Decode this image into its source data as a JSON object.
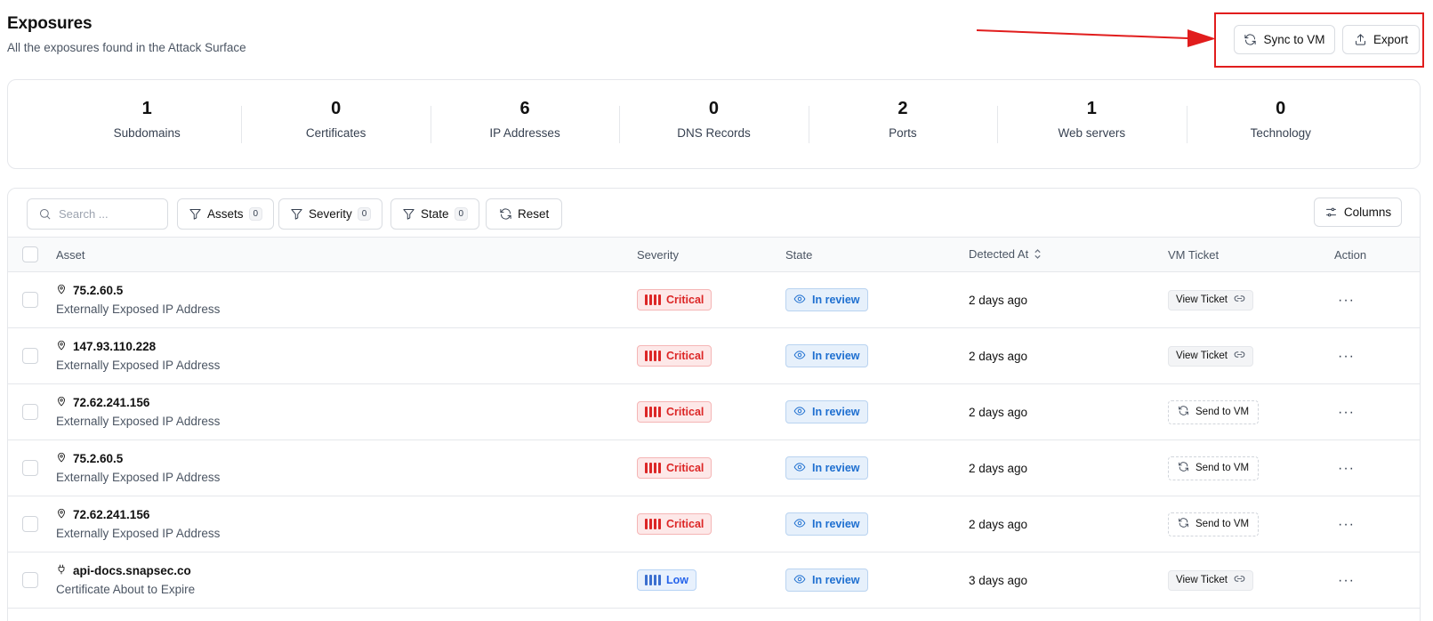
{
  "page": {
    "title": "Exposures",
    "subtitle": "All the exposures found in the Attack Surface"
  },
  "actions": {
    "sync_label": "Sync to VM",
    "export_label": "Export"
  },
  "annotation": {
    "color": "#e11d1d"
  },
  "stats": [
    {
      "value": "1",
      "label": "Subdomains"
    },
    {
      "value": "0",
      "label": "Certificates"
    },
    {
      "value": "6",
      "label": "IP Addresses"
    },
    {
      "value": "0",
      "label": "DNS Records"
    },
    {
      "value": "2",
      "label": "Ports"
    },
    {
      "value": "1",
      "label": "Web servers"
    },
    {
      "value": "0",
      "label": "Technology"
    }
  ],
  "toolbar": {
    "search_placeholder": "Search ...",
    "filters": [
      {
        "label": "Assets",
        "count": "0"
      },
      {
        "label": "Severity",
        "count": "0"
      },
      {
        "label": "State",
        "count": "0"
      }
    ],
    "reset_label": "Reset",
    "columns_label": "Columns"
  },
  "table": {
    "columns": {
      "asset": "Asset",
      "severity": "Severity",
      "state": "State",
      "detected_at": "Detected At",
      "vm_ticket": "VM Ticket",
      "action": "Action"
    },
    "rows": [
      {
        "asset": "75.2.60.5",
        "asset_icon": "location-pin-icon",
        "description": "Externally Exposed IP Address",
        "severity": "Critical",
        "state": "In review",
        "detected": "2 days ago",
        "vm": "View Ticket",
        "vm_type": "view"
      },
      {
        "asset": "147.93.110.228",
        "asset_icon": "location-pin-icon",
        "description": "Externally Exposed IP Address",
        "severity": "Critical",
        "state": "In review",
        "detected": "2 days ago",
        "vm": "View Ticket",
        "vm_type": "view"
      },
      {
        "asset": "72.62.241.156",
        "asset_icon": "location-pin-icon",
        "description": "Externally Exposed IP Address",
        "severity": "Critical",
        "state": "In review",
        "detected": "2 days ago",
        "vm": "Send to VM",
        "vm_type": "send"
      },
      {
        "asset": "75.2.60.5",
        "asset_icon": "location-pin-icon",
        "description": "Externally Exposed IP Address",
        "severity": "Critical",
        "state": "In review",
        "detected": "2 days ago",
        "vm": "Send to VM",
        "vm_type": "send"
      },
      {
        "asset": "72.62.241.156",
        "asset_icon": "location-pin-icon",
        "description": "Externally Exposed IP Address",
        "severity": "Critical",
        "state": "In review",
        "detected": "2 days ago",
        "vm": "Send to VM",
        "vm_type": "send"
      },
      {
        "asset": "api-docs.snapsec.co",
        "asset_icon": "plug-icon",
        "description": "Certificate About to Expire",
        "severity": "Low",
        "state": "In review",
        "detected": "3 days ago",
        "vm": "View Ticket",
        "vm_type": "view"
      }
    ]
  },
  "colors": {
    "critical": "#dc2626",
    "low": "#2563eb",
    "state": "#1e6fd0"
  }
}
